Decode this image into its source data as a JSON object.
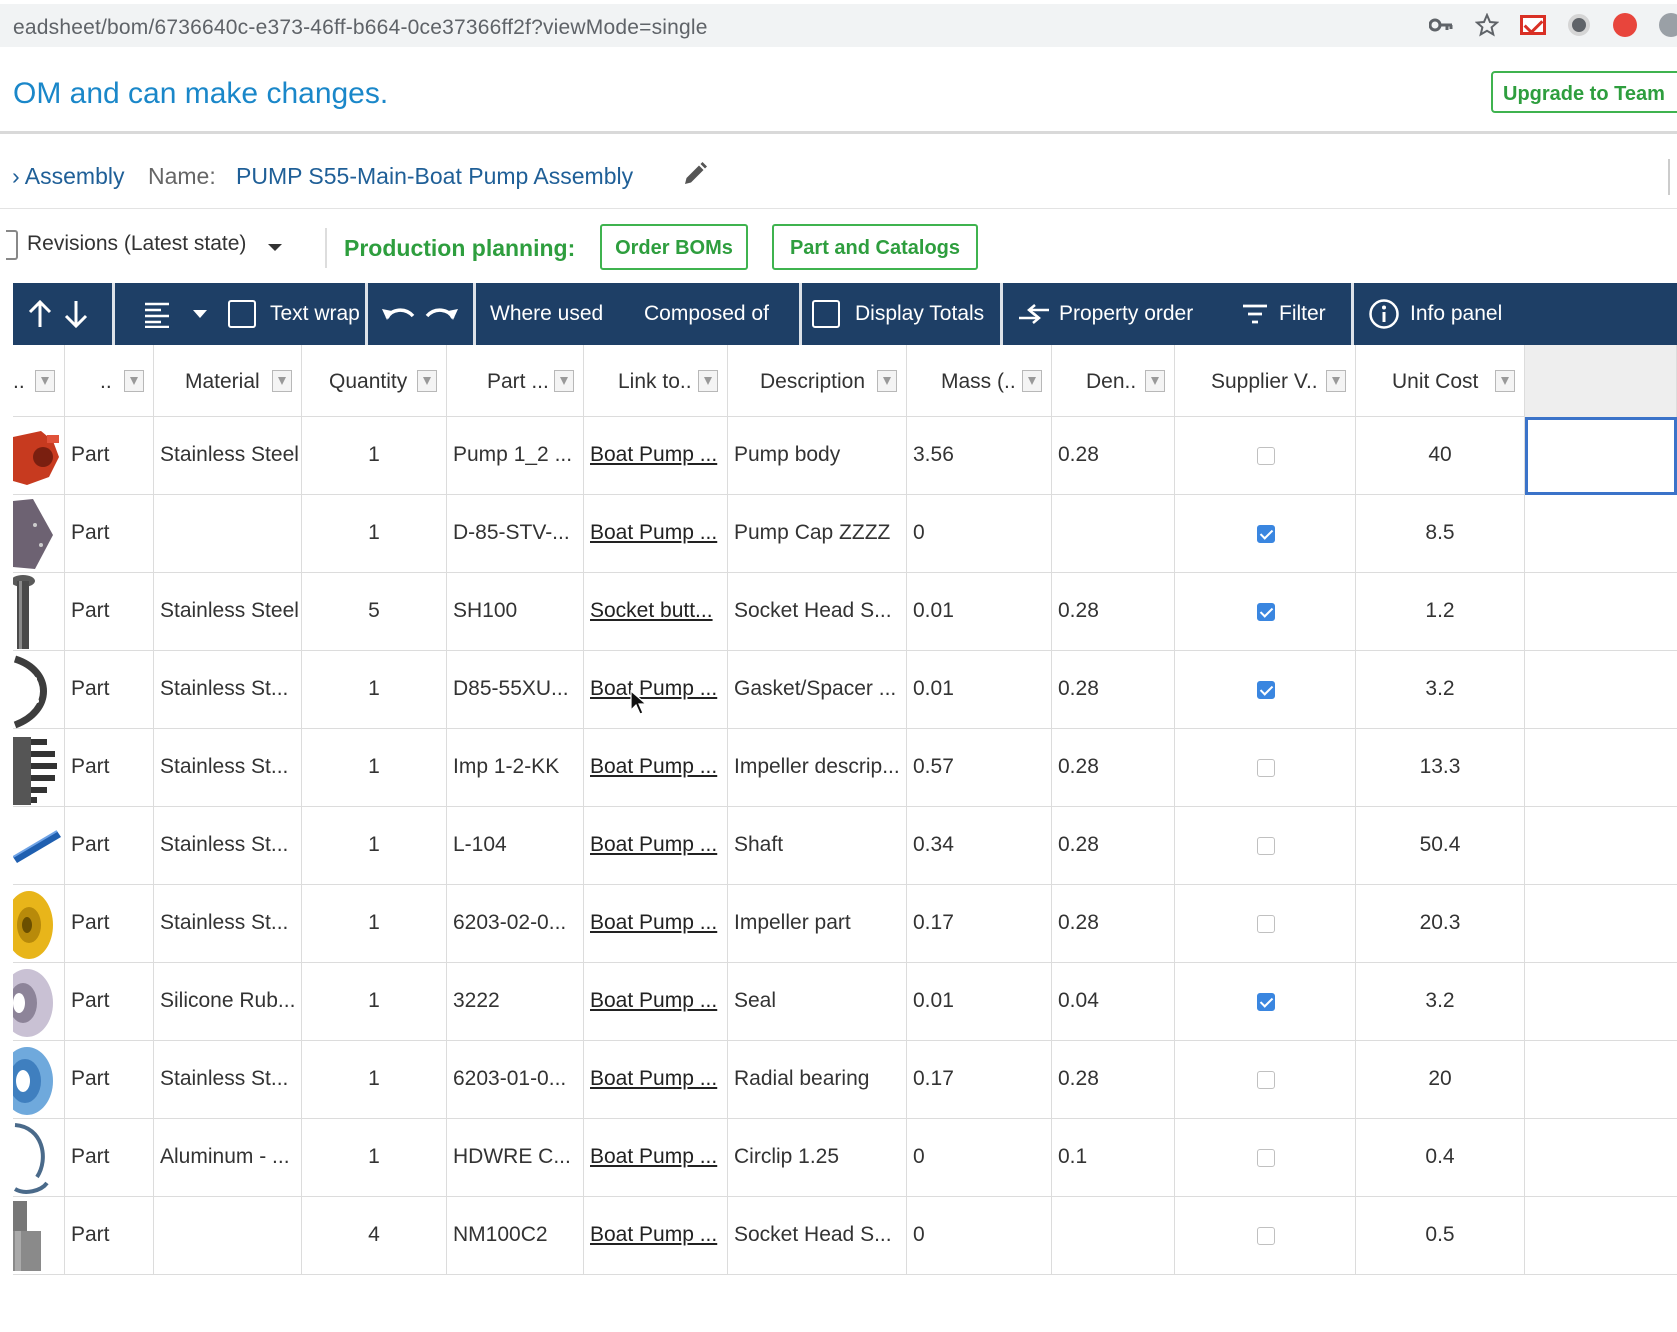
{
  "browser": {
    "url": "eadsheet/bom/6736640c-e373-46ff-b664-0ce37366ff2f?viewMode=single",
    "icons": [
      "key-icon",
      "star-icon",
      "gmail-extension-icon",
      "dark-circle-extension-icon",
      "red-extension-icon",
      "grey-extension-icon"
    ]
  },
  "banner": {
    "text": "OM and can make changes.",
    "upgrade_label": "Upgrade to Team"
  },
  "name_row": {
    "crumb": "› Assembly",
    "name_label": "Name:",
    "name_value": "PUMP S55-Main-Boat Pump Assembly"
  },
  "production": {
    "revisions_label": "Revisions (Latest state)",
    "planning_label": "Production planning:",
    "order_boms": "Order BOMs",
    "part_catalogs": "Part and Catalogs"
  },
  "toolbar": {
    "text_wrap": "Text wrap",
    "where_used": "Where used",
    "composed_of": "Composed of",
    "display_totals": "Display Totals",
    "property_order": "Property order",
    "filter": "Filter",
    "info_panel": "Info panel"
  },
  "columns": [
    "..",
    "..",
    "Material",
    "Quantity",
    "Part ...",
    "Link to..",
    "Description",
    "Mass (..",
    "Den..",
    "Supplier V..",
    "Unit Cost"
  ],
  "rows": [
    {
      "type": "Part",
      "material": "Stainless Steel",
      "quantity": "1",
      "part": "Pump 1_2 ...",
      "link": "Boat Pump ...",
      "description": "Pump body",
      "mass": "3.56",
      "density": "0.28",
      "supplier": false,
      "unit_cost": "40",
      "thumb": "pump-body"
    },
    {
      "type": "Part",
      "material": "",
      "quantity": "1",
      "part": "D-85-STV-...",
      "link": "Boat Pump ...",
      "description": "Pump Cap ZZZZ",
      "mass": "0",
      "density": "",
      "supplier": true,
      "unit_cost": "8.5",
      "thumb": "pump-cap"
    },
    {
      "type": "Part",
      "material": "Stainless Steel",
      "quantity": "5",
      "part": "SH100",
      "link": "Socket butt...",
      "description": "Socket Head S...",
      "mass": "0.01",
      "density": "0.28",
      "supplier": true,
      "unit_cost": "1.2",
      "thumb": "screw"
    },
    {
      "type": "Part",
      "material": "Stainless St...",
      "quantity": "1",
      "part": "D85-55XU...",
      "link": "Boat Pump ...",
      "description": "Gasket/Spacer ...",
      "mass": "0.01",
      "density": "0.28",
      "supplier": true,
      "unit_cost": "3.2",
      "thumb": "gasket"
    },
    {
      "type": "Part",
      "material": "Stainless St...",
      "quantity": "1",
      "part": "Imp 1-2-KK",
      "link": "Boat Pump ...",
      "description": "Impeller descrip...",
      "mass": "0.57",
      "density": "0.28",
      "supplier": false,
      "unit_cost": "13.3",
      "thumb": "impeller"
    },
    {
      "type": "Part",
      "material": "Stainless St...",
      "quantity": "1",
      "part": "L-104",
      "link": "Boat Pump ...",
      "description": "Shaft",
      "mass": "0.34",
      "density": "0.28",
      "supplier": false,
      "unit_cost": "50.4",
      "thumb": "shaft"
    },
    {
      "type": "Part",
      "material": "Stainless St...",
      "quantity": "1",
      "part": "6203-02-0...",
      "link": "Boat Pump ...",
      "description": "Impeller part",
      "mass": "0.17",
      "density": "0.28",
      "supplier": false,
      "unit_cost": "20.3",
      "thumb": "impeller-part"
    },
    {
      "type": "Part",
      "material": "Silicone Rub...",
      "quantity": "1",
      "part": "3222",
      "link": "Boat Pump ...",
      "description": "Seal",
      "mass": "0.01",
      "density": "0.04",
      "supplier": true,
      "unit_cost": "3.2",
      "thumb": "seal"
    },
    {
      "type": "Part",
      "material": "Stainless St...",
      "quantity": "1",
      "part": "6203-01-0...",
      "link": "Boat Pump ...",
      "description": "Radial bearing",
      "mass": "0.17",
      "density": "0.28",
      "supplier": false,
      "unit_cost": "20",
      "thumb": "bearing"
    },
    {
      "type": "Part",
      "material": "Aluminum - ...",
      "quantity": "1",
      "part": "HDWRE C...",
      "link": "Boat Pump ...",
      "description": "Circlip 1.25",
      "mass": "0",
      "density": "0.1",
      "supplier": false,
      "unit_cost": "0.4",
      "thumb": "circlip"
    },
    {
      "type": "Part",
      "material": "",
      "quantity": "4",
      "part": "NM100C2",
      "link": "Boat Pump ...",
      "description": "Socket Head S...",
      "mass": "0",
      "density": "",
      "supplier": false,
      "unit_cost": "0.5",
      "thumb": "bolt"
    }
  ],
  "colors": {
    "toolbar": "#1e3f66",
    "banner_text": "#1a87c9",
    "green": "#2e9e3e",
    "checkbox_on": "#3a86e0"
  }
}
